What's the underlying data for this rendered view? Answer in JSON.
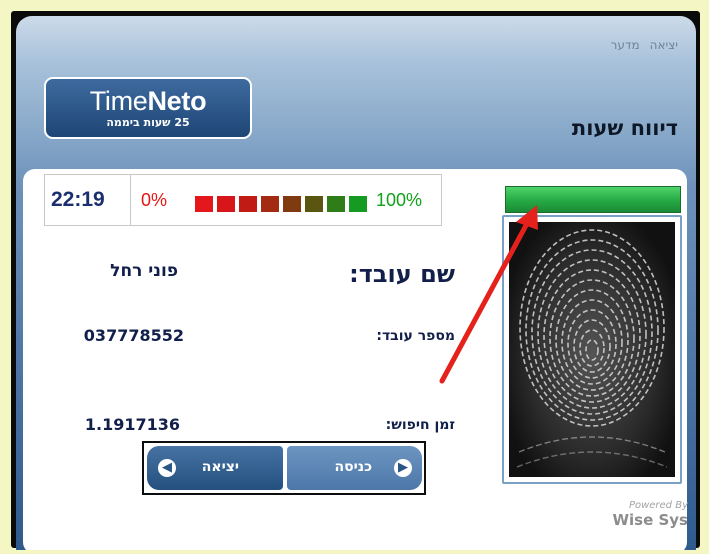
{
  "top_links": {
    "exit": "יציאה",
    "store": "מדער"
  },
  "logo": {
    "brand_light": "Time",
    "brand_bold": "Neto",
    "subtitle": "25 שעות ביממה"
  },
  "page_title": "דיווח שעות",
  "status": {
    "clock": "22:19",
    "percent_low": "0%",
    "percent_high": "100%",
    "meter_segments": [
      "#e3171c",
      "#d8161a",
      "#c01b15",
      "#a22b12",
      "#7f3a0f",
      "#5a5510",
      "#2f7d18",
      "#159a22"
    ]
  },
  "employee": {
    "name_label": "שם עובד:",
    "name_value": "פוני רחל",
    "id_label": "מספר עובד:",
    "id_value": "037778552",
    "search_time_label": "זמן חיפוש:",
    "search_time_value": "1.1917136"
  },
  "buttons": {
    "exit_label": "יציאה",
    "enter_label": "כניסה"
  },
  "powered_by": {
    "line1": "Powered By",
    "line2": "Wise Sys"
  },
  "colors": {
    "scan_progress": "#26a944",
    "annotation_arrow": "#e5211b"
  }
}
